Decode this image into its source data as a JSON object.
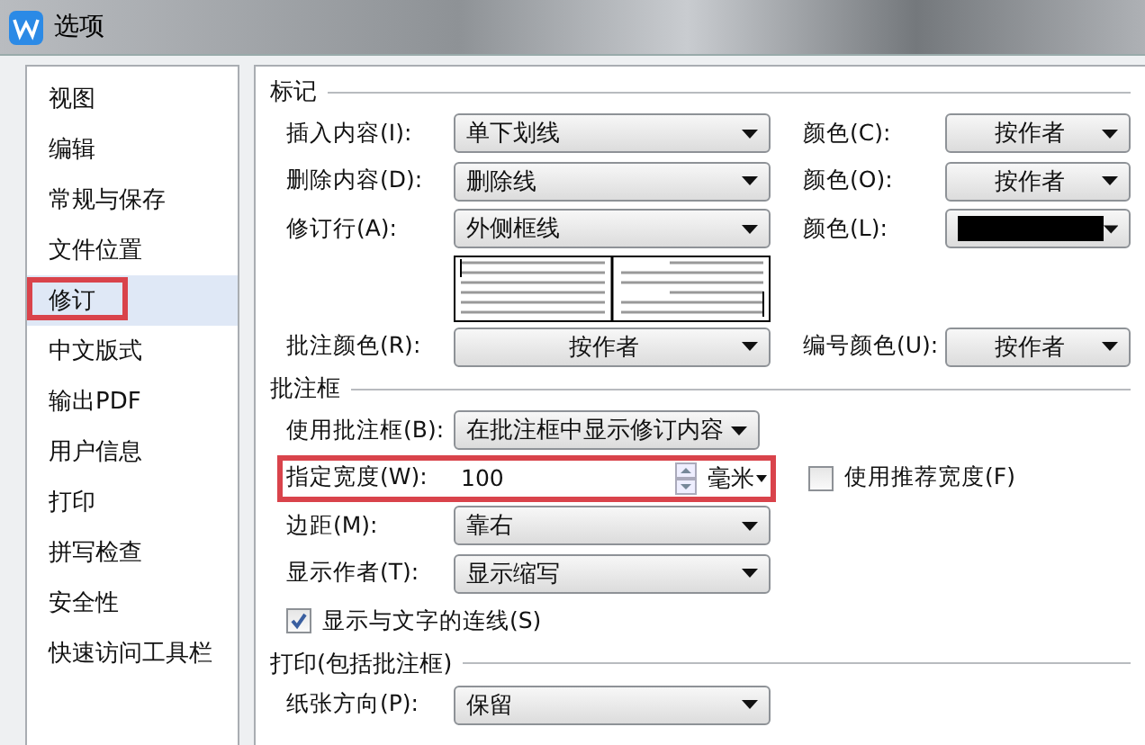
{
  "window": {
    "title": "选项"
  },
  "sidebar": {
    "items": [
      {
        "label": "视图",
        "selected": false,
        "highlighted": false
      },
      {
        "label": "编辑",
        "selected": false,
        "highlighted": false
      },
      {
        "label": "常规与保存",
        "selected": false,
        "highlighted": false
      },
      {
        "label": "文件位置",
        "selected": false,
        "highlighted": false
      },
      {
        "label": "修订",
        "selected": true,
        "highlighted": true
      },
      {
        "label": "中文版式",
        "selected": false,
        "highlighted": false
      },
      {
        "label": "输出PDF",
        "selected": false,
        "highlighted": false
      },
      {
        "label": "用户信息",
        "selected": false,
        "highlighted": false
      },
      {
        "label": "打印",
        "selected": false,
        "highlighted": false
      },
      {
        "label": "拼写检查",
        "selected": false,
        "highlighted": false
      },
      {
        "label": "安全性",
        "selected": false,
        "highlighted": false
      },
      {
        "label": "快速访问工具栏",
        "selected": false,
        "highlighted": false
      }
    ]
  },
  "sections": [
    {
      "title": "标记",
      "rows": [
        {
          "kind": "field",
          "label": "插入内容(I):",
          "field": {
            "kind": "dropdown",
            "value": "单下划线"
          },
          "side": {
            "label": "颜色(C):",
            "field": {
              "kind": "dropdown",
              "value": "按作者",
              "centered": true
            }
          }
        },
        {
          "kind": "field",
          "label": "删除内容(D):",
          "field": {
            "kind": "dropdown",
            "value": "删除线"
          },
          "side": {
            "label": "颜色(O):",
            "field": {
              "kind": "dropdown",
              "value": "按作者",
              "centered": true
            }
          }
        },
        {
          "kind": "field",
          "label": "修订行(A):",
          "field": {
            "kind": "dropdown",
            "value": "外侧框线"
          },
          "side": {
            "label": "颜色(L):",
            "field": {
              "kind": "swatch",
              "color": "#000000"
            }
          }
        },
        {
          "kind": "preview"
        },
        {
          "kind": "field",
          "label": "批注颜色(R):",
          "field": {
            "kind": "dropdown",
            "value": "按作者",
            "centered": true
          },
          "side": {
            "label": "编号颜色(U):",
            "field": {
              "kind": "dropdown",
              "value": "按作者",
              "centered": true
            }
          }
        }
      ]
    },
    {
      "title": "批注框",
      "rows": [
        {
          "kind": "field",
          "label": "使用批注框(B):",
          "field": {
            "kind": "dropdown",
            "value": "在批注框中显示修订内容",
            "narrow": true
          }
        },
        {
          "kind": "field",
          "label": "指定宽度(W):",
          "highlighted": true,
          "field": {
            "kind": "spinner",
            "value": "100",
            "unit": "毫米"
          },
          "side": {
            "kind": "checkbox",
            "label": "使用推荐宽度(F)",
            "checked": false
          }
        },
        {
          "kind": "field",
          "label": "边距(M):",
          "field": {
            "kind": "dropdown",
            "value": "靠右"
          }
        },
        {
          "kind": "field",
          "label": "显示作者(T):",
          "field": {
            "kind": "dropdown",
            "value": "显示缩写"
          }
        },
        {
          "kind": "checkbox",
          "label": "显示与文字的连线(S)",
          "checked": true
        }
      ]
    },
    {
      "title": "打印(包括批注框)",
      "rows": [
        {
          "kind": "field",
          "label": "纸张方向(P):",
          "field": {
            "kind": "dropdown",
            "value": "保留"
          }
        }
      ]
    }
  ]
}
